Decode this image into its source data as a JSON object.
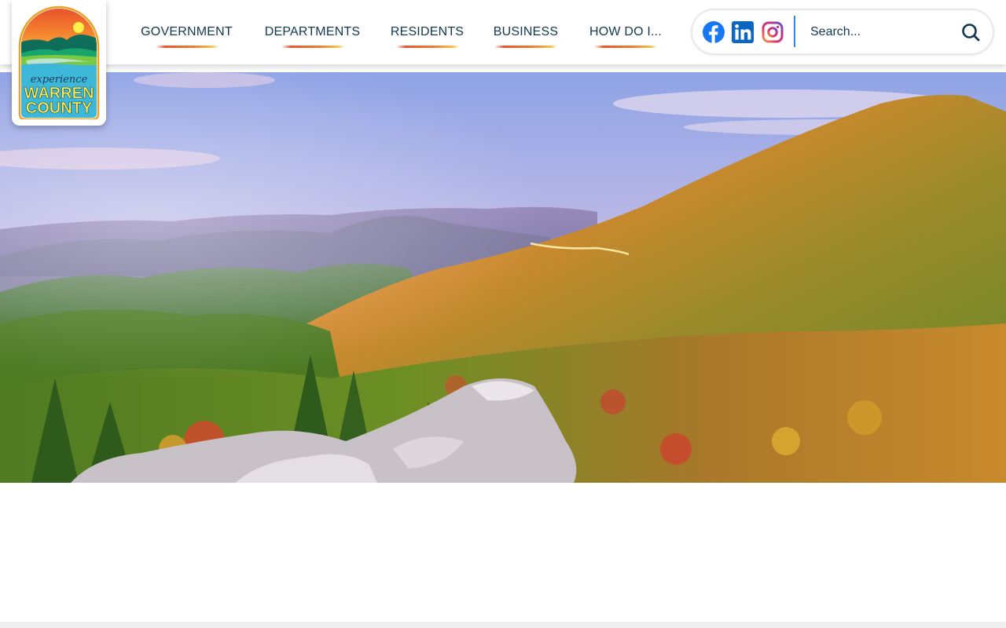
{
  "site": {
    "logo": {
      "script_text": "experience",
      "line1": "WARREN",
      "line2": "COUNTY",
      "alt": "Experience Warren County"
    }
  },
  "nav": {
    "items": [
      {
        "label": "GOVERNMENT"
      },
      {
        "label": "DEPARTMENTS"
      },
      {
        "label": "RESIDENTS"
      },
      {
        "label": "BUSINESS"
      },
      {
        "label": "HOW DO I..."
      }
    ]
  },
  "social": {
    "links": [
      {
        "icon": "facebook-icon",
        "color": "#1877f2"
      },
      {
        "icon": "linkedin-icon",
        "color": "#0a66c2"
      },
      {
        "icon": "instagram-icon",
        "color": "#c13584"
      }
    ]
  },
  "search": {
    "placeholder": "Search...",
    "icon": "search-icon"
  },
  "hero": {
    "description": ""
  },
  "colors": {
    "nav_text": "#12384f",
    "accent_blue": "#2a8fd6",
    "underline_start": "#e8552f",
    "underline_end": "#f7c24a"
  }
}
